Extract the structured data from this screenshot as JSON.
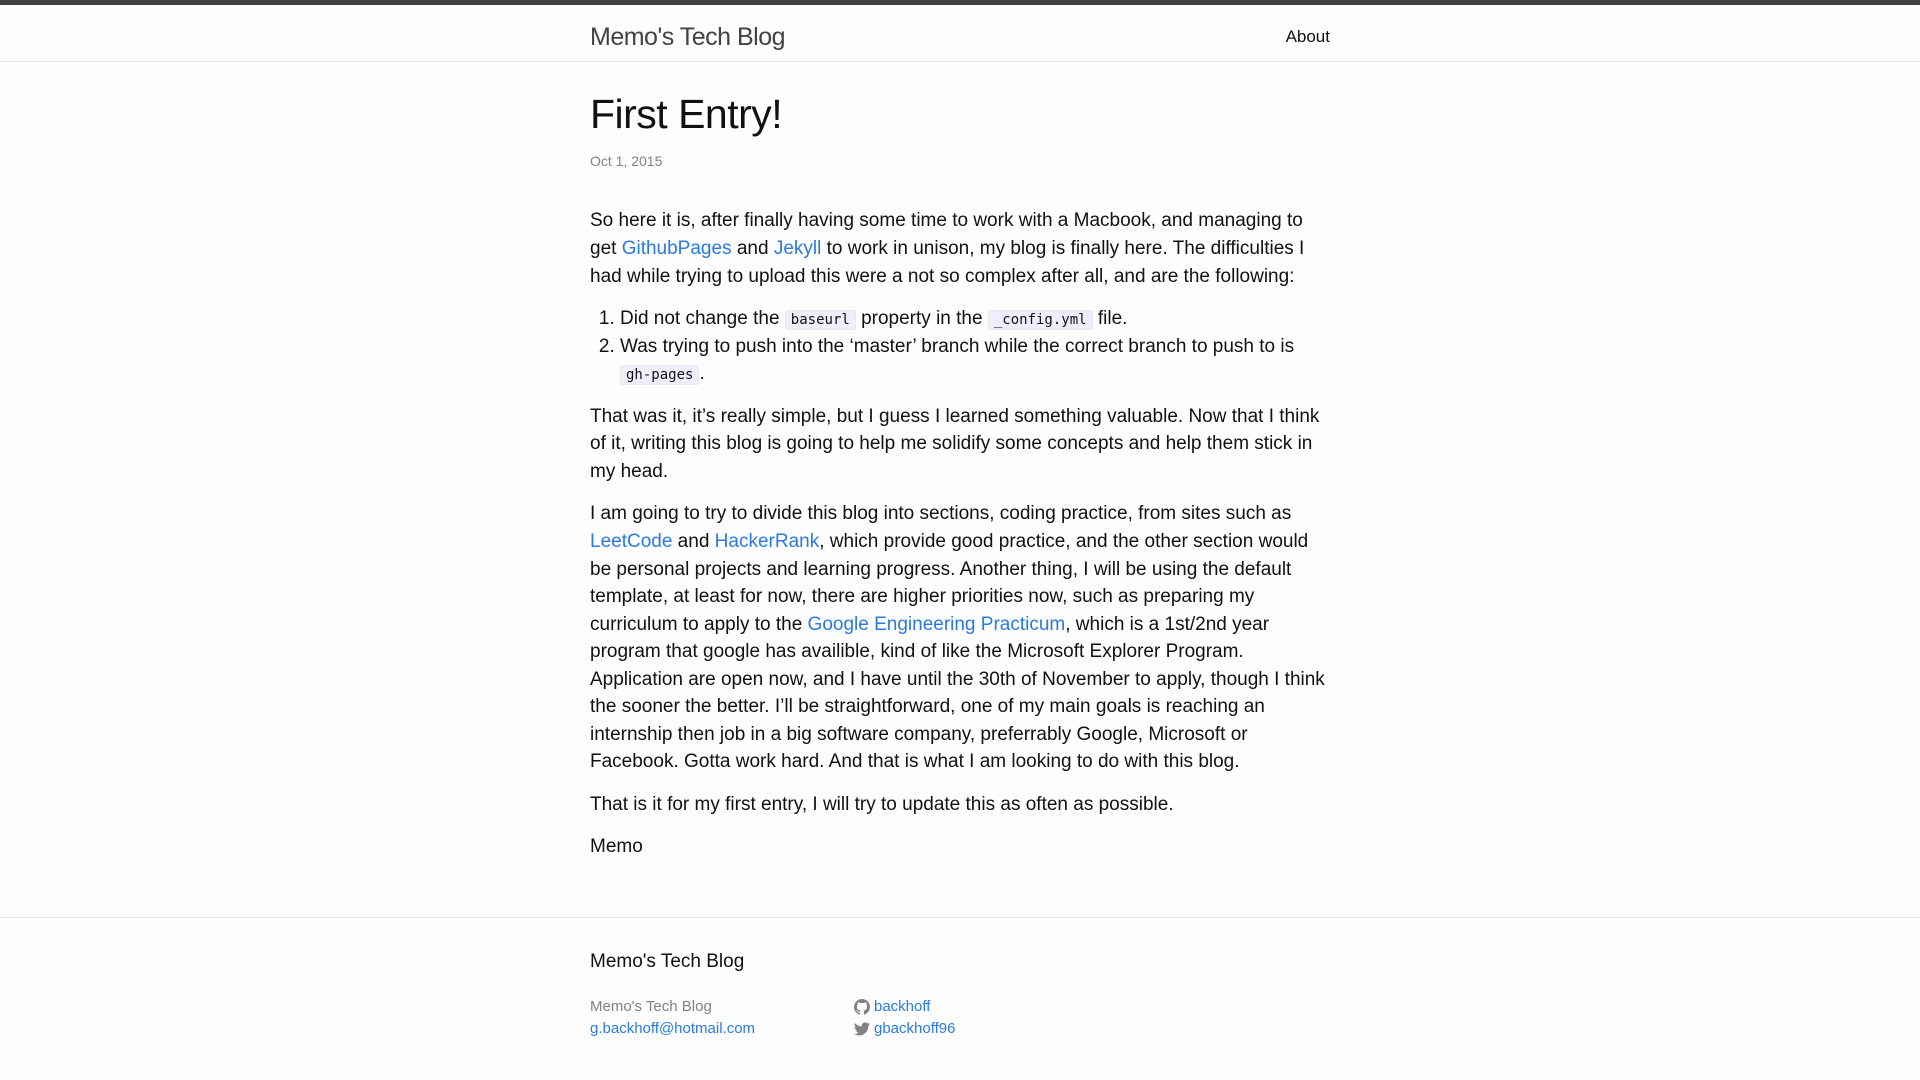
{
  "header": {
    "site_title": "Memo's Tech Blog",
    "nav_about": "About"
  },
  "post": {
    "title": "First Entry!",
    "date": "Oct 1, 2015",
    "p1": {
      "text1": "So here it is, after finally having some time to work with a Macbook, and managing to get ",
      "link1": "GithubPages",
      "text2": " and ",
      "link2": "Jekyll",
      "text3": " to work in unison, my blog is finally here. The difficulties I had while trying to upload this were a not so complex after all, and are the following:"
    },
    "list": [
      {
        "before": "Did not change the ",
        "code1": "baseurl",
        "mid": " property in the ",
        "code2": "_config.yml",
        "after": " file."
      },
      {
        "before": "Was trying to push into the ‘master’ branch while the correct branch to push to is ",
        "code1": "gh-pages",
        "after": "."
      }
    ],
    "p2": "That was it, it’s really simple, but I guess I learned something valuable. Now that I think of it, writing this blog is going to help me solidify some concepts and help them stick in my head.",
    "p3": {
      "text1": "I am going to try to divide this blog into sections, coding practice, from sites such as ",
      "link1": "LeetCode",
      "text2": " and ",
      "link2": "HackerRank",
      "text3": ", which provide good practice, and the other section would be personal projects and learning progress. Another thing, I will be using the default template, at least for now, there are higher priorities now, such as preparing my curriculum to apply to the ",
      "link3": "Google Engineering Practicum",
      "text4": ", which is a 1st/2nd year program that google has availible, kind of like the Microsoft Explorer Program. Application are open now, and I have until the 30th of November to apply, though I think the sooner the better. I’ll be straightforward, one of my main goals is reaching an internship then job in a big software company, preferrably Google, Microsoft or Facebook. Gotta work hard. And that is what I am looking to do with this blog."
    },
    "p4": "That is it for my first entry, I will try to update this as often as possible.",
    "signature": "Memo"
  },
  "footer": {
    "heading": "Memo's Tech Blog",
    "name": "Memo's Tech Blog",
    "email": "g.backhoff@hotmail.com",
    "github_user": "backhoff",
    "twitter_user": "gbackhoff96",
    "github_icon": "github-icon",
    "twitter_icon": "twitter-icon"
  },
  "colors": {
    "link": "#2a7ae2",
    "meta": "#828282",
    "topbar": "#424242"
  }
}
